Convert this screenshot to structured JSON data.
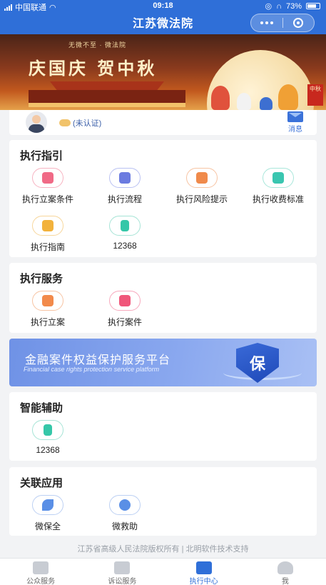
{
  "status_bar": {
    "carrier": "中国联通",
    "time": "09:18",
    "battery": "73%"
  },
  "nav": {
    "title": "江苏微法院"
  },
  "banner": {
    "logo_text": "无微不至 · 微法院",
    "headline": "庆国庆  贺中秋",
    "tag": "中秋"
  },
  "user": {
    "auth_status": "(未认证)",
    "message_label": "消息"
  },
  "sections": {
    "guide": {
      "title": "执行指引",
      "items": [
        {
          "label": "执行立案条件",
          "icon": "document-icon",
          "color": "#f06a86"
        },
        {
          "label": "执行流程",
          "icon": "list-icon",
          "color": "#6b7be0"
        },
        {
          "label": "执行风险提示",
          "icon": "shield-icon",
          "color": "#f08a4b"
        },
        {
          "label": "执行收费标准",
          "icon": "wallet-icon",
          "color": "#3ac6b0"
        },
        {
          "label": "执行指南",
          "icon": "card-icon",
          "color": "#f2b23c"
        },
        {
          "label": "12368",
          "icon": "phone-icon",
          "color": "#35c7a8"
        }
      ]
    },
    "service": {
      "title": "执行服务",
      "items": [
        {
          "label": "执行立案",
          "icon": "file-icon",
          "color": "#f28a4b"
        },
        {
          "label": "执行案件",
          "icon": "gavel-icon",
          "color": "#f0567a"
        }
      ]
    },
    "finance": {
      "title": "金融案件权益保护服务平台",
      "subtitle": "Financial case rights protection service platform",
      "shield_char": "保"
    },
    "assist": {
      "title": "智能辅助",
      "items": [
        {
          "label": "12368",
          "icon": "phone-icon",
          "color": "#35c7a8"
        }
      ]
    },
    "related": {
      "title": "关联应用",
      "items": [
        {
          "label": "微保全",
          "icon": "bird-icon",
          "color": "#5a8fe6"
        },
        {
          "label": "微救助",
          "icon": "people-icon",
          "color": "#5a8fe6"
        }
      ]
    }
  },
  "footer": {
    "copyright": "江苏省高级人民法院版权所有 | 北明软件技术支持"
  },
  "tabbar": {
    "tabs": [
      {
        "label": "公众服务"
      },
      {
        "label": "诉讼服务"
      },
      {
        "label": "执行中心"
      },
      {
        "label": "我"
      }
    ]
  }
}
